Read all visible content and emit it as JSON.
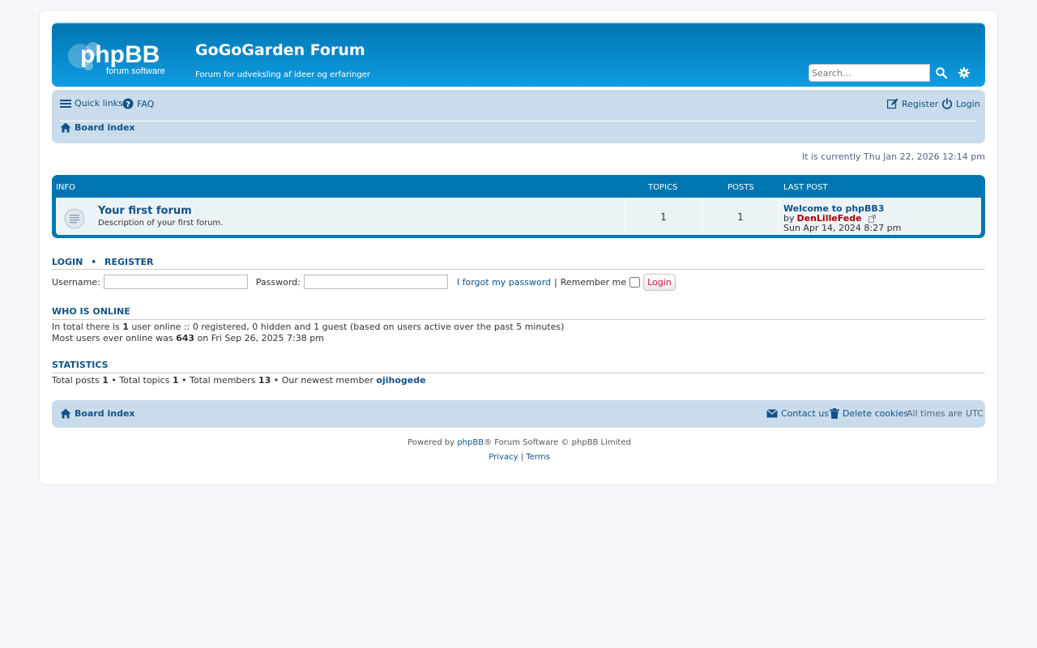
{
  "colors": {
    "header_bg": "#12a3eb",
    "navbar_bg": "#cadceb",
    "forumlist_header": "#0076b1",
    "forum_row_bg": "#ecf3f7",
    "link": "#105289",
    "author": "#aa0000",
    "login_button_text": "#d31141"
  },
  "header": {
    "logo_alt": "phpBB",
    "logo_text": "phpBB",
    "logo_subtext": "forum software",
    "site_title": "GoGoGarden Forum",
    "site_description": "Forum for udveksling af ideer og erfaringer",
    "search_placeholder": "Search…",
    "search_icon": "search-icon",
    "advanced_search_icon": "gear-icon"
  },
  "navbar": {
    "quick_links": "Quick links",
    "faq": "FAQ",
    "register": "Register",
    "login": "Login",
    "board_index": "Board index"
  },
  "current_time": "It is currently Thu Jan 22, 2026 12:14 pm",
  "forumlist": {
    "headers": {
      "info": "Info",
      "topics": "Topics",
      "posts": "Posts",
      "last_post": "Last post"
    },
    "forums": [
      {
        "name": "Your first forum",
        "description": "Description of your first forum.",
        "topics": "1",
        "posts": "1",
        "last_post_title": "Welcome to phpBB3",
        "last_post_by": "by",
        "last_post_author": "DenLilleFede",
        "last_post_date": "Sun Apr 14, 2024 8:27 pm"
      }
    ]
  },
  "login_section": {
    "login_link": "Login",
    "separator": "•",
    "register_link": "Register",
    "username_label": "Username:",
    "password_label": "Password:",
    "forgot_password": "I forgot my password",
    "pipe": "|",
    "remember_me": "Remember me",
    "login_button": "Login"
  },
  "who_is_online": {
    "title": "Who is online",
    "line1_prefix": "In total there is",
    "line1_count": "1",
    "line1_suffix": "user online :: 0 registered, 0 hidden and 1 guest (based on users active over the past 5 minutes)",
    "line2_prefix": "Most users ever online was",
    "line2_count": "643",
    "line2_suffix": "on Fri Sep 26, 2025 7:38 pm"
  },
  "statistics": {
    "title": "Statistics",
    "total_posts_label": "Total posts",
    "total_posts": "1",
    "total_topics_label": "• Total topics",
    "total_topics": "1",
    "total_members_label": "• Total members",
    "total_members": "13",
    "newest_member_label": "• Our newest member",
    "newest_member": "ojihogede"
  },
  "footer": {
    "board_index": "Board index",
    "contact_us": "Contact us",
    "delete_cookies": "Delete cookies",
    "timezone_label": "All times are",
    "timezone": "UTC",
    "powered_by": "Powered by",
    "phpbb_link": "phpBB",
    "copyright": "® Forum Software © phpBB Limited",
    "privacy": "Privacy",
    "pipe": "|",
    "terms": "Terms"
  }
}
